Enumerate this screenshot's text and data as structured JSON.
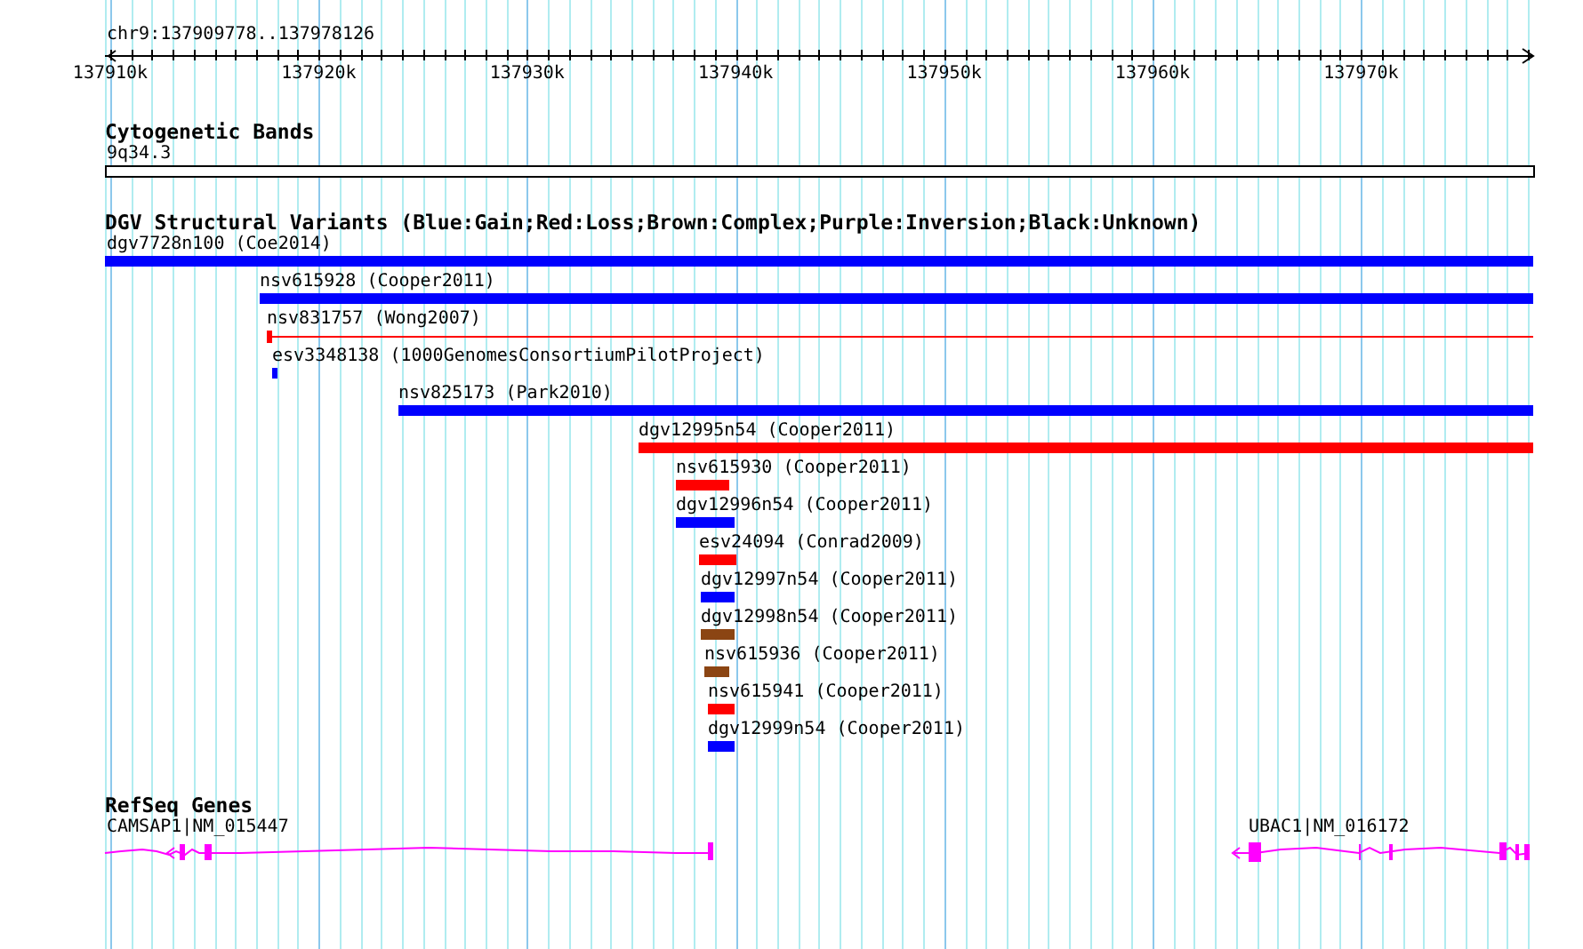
{
  "ruler": {
    "position": "chr9:137909778..137978126",
    "ticks": [
      "137910k",
      "137920k",
      "137930k",
      "137940k",
      "137950k",
      "137960k",
      "137970k"
    ]
  },
  "tracks": [
    {
      "kind": "cytoband",
      "title": "Cytogenetic Bands",
      "band": "9q34.3"
    },
    {
      "kind": "variants",
      "title": "DGV Structural Variants (Blue:Gain;Red:Loss;Brown:Complex;Purple:Inversion;Black:Unknown)",
      "features": [
        {
          "label": "dgv7728n100 (Coe2014)",
          "color": "#0000ff"
        },
        {
          "label": "nsv615928 (Cooper2011)",
          "color": "#0000ff"
        },
        {
          "label": "nsv831757 (Wong2007)",
          "color": "#ff0000"
        },
        {
          "label": "esv3348138 (1000GenomesConsortiumPilotProject)",
          "color": "#0000ff"
        },
        {
          "label": "nsv825173 (Park2010)",
          "color": "#0000ff"
        },
        {
          "label": "dgv12995n54 (Cooper2011)",
          "color": "#ff0000"
        },
        {
          "label": "nsv615930 (Cooper2011)",
          "color": "#ff0000"
        },
        {
          "label": "dgv12996n54 (Cooper2011)",
          "color": "#0000ff"
        },
        {
          "label": "esv24094 (Conrad2009)",
          "color": "#ff0000"
        },
        {
          "label": "dgv12997n54 (Cooper2011)",
          "color": "#0000ff"
        },
        {
          "label": "dgv12998n54 (Cooper2011)",
          "color": "#8b4513"
        },
        {
          "label": "nsv615936 (Cooper2011)",
          "color": "#8b4513"
        },
        {
          "label": "nsv615941 (Cooper2011)",
          "color": "#ff0000"
        },
        {
          "label": "dgv12999n54 (Cooper2011)",
          "color": "#0000ff"
        }
      ]
    },
    {
      "kind": "genes",
      "title": "RefSeq Genes",
      "genes": [
        {
          "label": "CAMSAP1|NM_015447"
        },
        {
          "label": "UBAC1|NM_016172"
        }
      ]
    }
  ]
}
